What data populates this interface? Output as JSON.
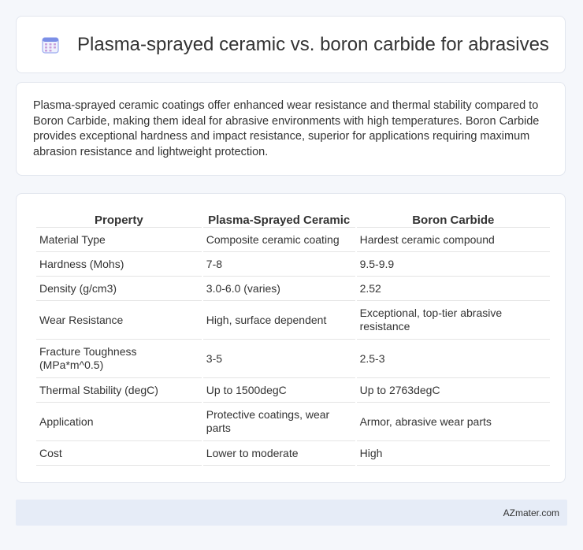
{
  "header": {
    "title": "Plasma-sprayed ceramic vs. boron carbide for abrasives",
    "icon": "calendar-icon"
  },
  "summary": {
    "text": "Plasma-sprayed ceramic coatings offer enhanced wear resistance and thermal stability compared to Boron Carbide, making them ideal for abrasive environments with high temperatures. Boron Carbide provides exceptional hardness and impact resistance, superior for applications requiring maximum abrasion resistance and lightweight protection."
  },
  "table": {
    "headers": [
      "Property",
      "Plasma-Sprayed Ceramic",
      "Boron Carbide"
    ],
    "rows": [
      [
        "Material Type",
        "Composite ceramic coating",
        "Hardest ceramic compound"
      ],
      [
        "Hardness (Mohs)",
        "7-8",
        "9.5-9.9"
      ],
      [
        "Density (g/cm3)",
        "3.0-6.0 (varies)",
        "2.52"
      ],
      [
        "Wear Resistance",
        "High, surface dependent",
        "Exceptional, top-tier abrasive resistance"
      ],
      [
        "Fracture Toughness (MPa*m^0.5)",
        "3-5",
        "2.5-3"
      ],
      [
        "Thermal Stability (degC)",
        "Up to 1500degC",
        "Up to 2763degC"
      ],
      [
        "Application",
        "Protective coatings, wear parts",
        "Armor, abrasive wear parts"
      ],
      [
        "Cost",
        "Lower to moderate",
        "High"
      ]
    ]
  },
  "footer": {
    "text": "AZmater.com"
  },
  "colors": {
    "background": "#f5f7fb",
    "footer_bg": "#e6ecf7",
    "icon_accent": "#7b8fe6"
  }
}
